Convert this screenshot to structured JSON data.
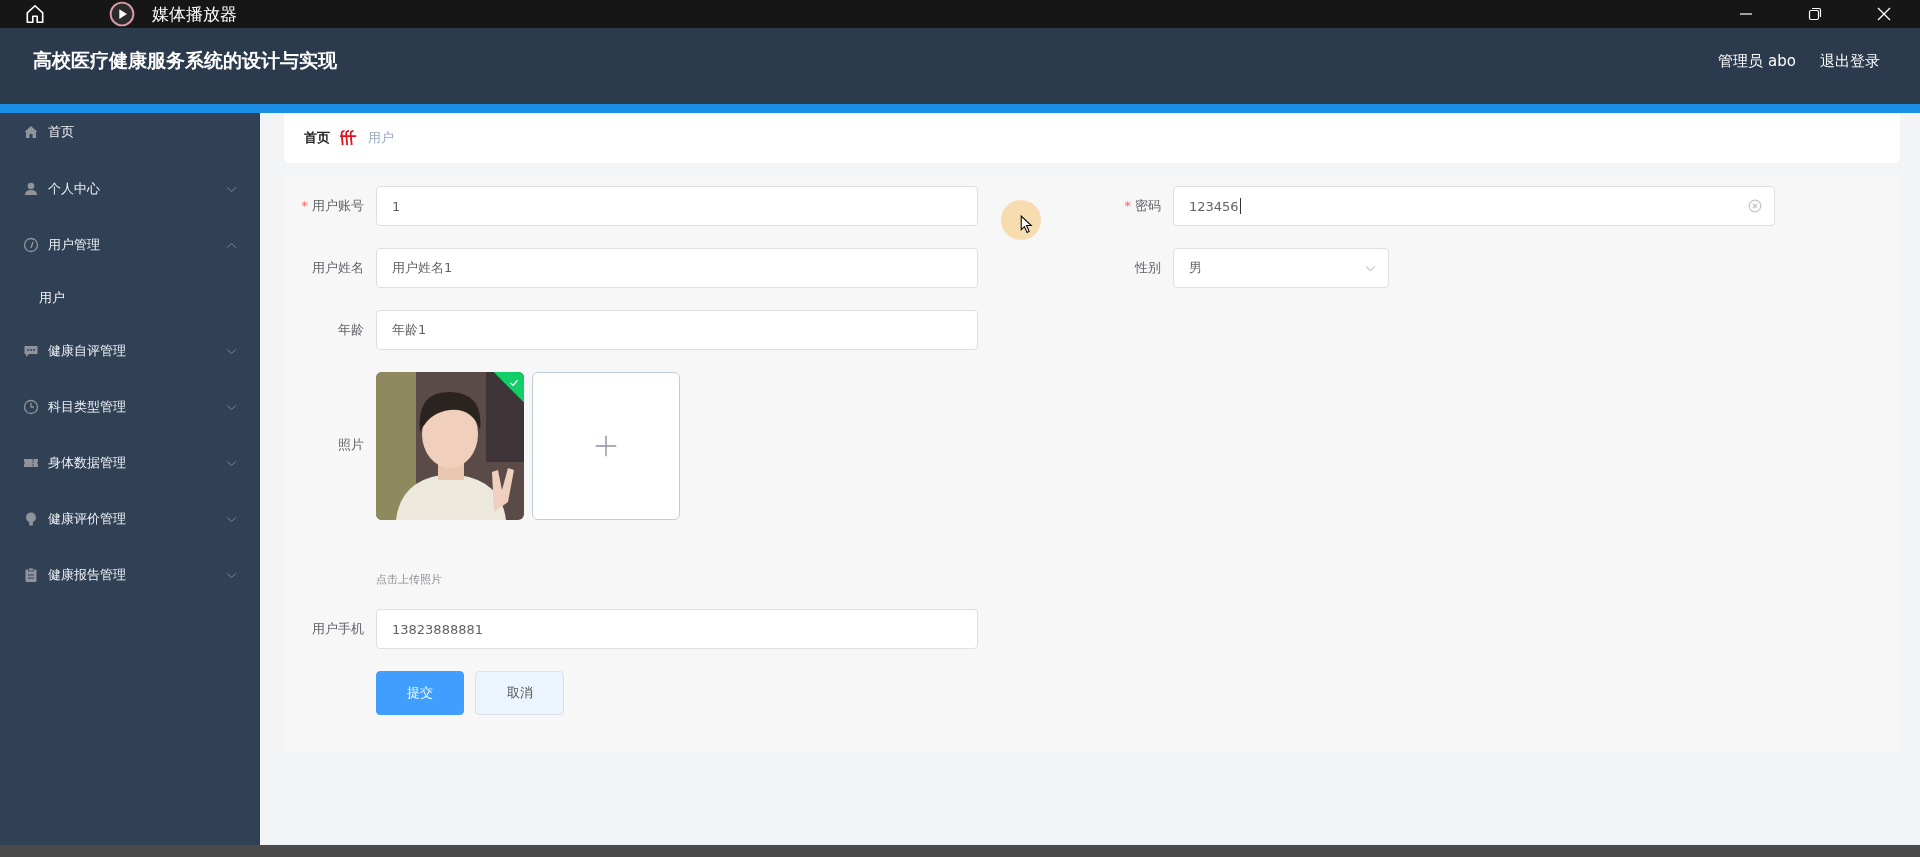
{
  "player": {
    "title": "媒体播放器"
  },
  "header": {
    "title": "高校医疗健康服务系统的设计与实现",
    "user": "管理员 abo",
    "logout": "退出登录"
  },
  "sidebar": {
    "items": [
      {
        "label": "首页"
      },
      {
        "label": "个人中心",
        "expanded": false
      },
      {
        "label": "用户管理",
        "expanded": true,
        "children": [
          {
            "label": "用户"
          }
        ]
      },
      {
        "label": "健康自评管理",
        "expanded": false
      },
      {
        "label": "科目类型管理",
        "expanded": false
      },
      {
        "label": "身体数据管理",
        "expanded": false
      },
      {
        "label": "健康评价管理",
        "expanded": false
      },
      {
        "label": "健康报告管理",
        "expanded": false
      }
    ]
  },
  "breadcrumb": [
    {
      "label": "首页",
      "current": false
    },
    {
      "label": "用户",
      "current": true
    }
  ],
  "form": {
    "left": [
      {
        "kind": "text",
        "required_mark": "*",
        "label": "用户账号",
        "value": "1",
        "clearable": false
      },
      {
        "kind": "text",
        "label": "用户姓名",
        "value": "用户姓名1",
        "clearable": false
      },
      {
        "kind": "text",
        "label": "年龄",
        "value": "年龄1",
        "clearable": false
      },
      {
        "kind": "upload",
        "label": "照片",
        "uploaded": true,
        "hint": "点击上传照片"
      },
      {
        "kind": "text",
        "label": "用户手机",
        "value": "13823888881",
        "clearable": false
      }
    ],
    "right": [
      {
        "kind": "text",
        "required_mark": "*",
        "label": "密码",
        "value": "123456",
        "clearable": true
      },
      {
        "kind": "select",
        "label": "性别",
        "value": "男"
      }
    ],
    "buttons": [
      {
        "label": "提交",
        "kind": "primary"
      },
      {
        "label": "取消",
        "kind": "default"
      }
    ]
  }
}
